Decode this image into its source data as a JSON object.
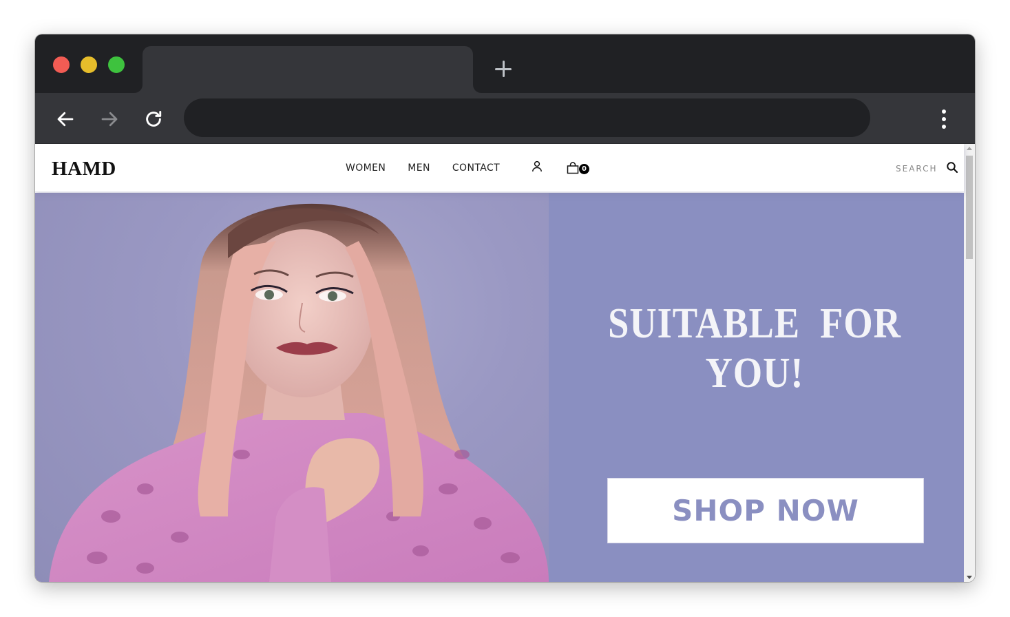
{
  "browser": {
    "tab_title": "",
    "address": "",
    "new_tab_icon": "plus-icon",
    "back_icon": "arrow-left-icon",
    "forward_icon": "arrow-right-icon",
    "reload_icon": "reload-icon",
    "menu_icon": "kebab-menu-icon",
    "colors": {
      "frame": "#202124",
      "toolbar": "#35363a",
      "close": "#f25c54",
      "minimize": "#e6bd2b",
      "maximize": "#3ec23e"
    }
  },
  "site": {
    "logo": "HAMD",
    "nav": {
      "women": "WOMEN",
      "men": "MEN",
      "contact": "CONTACT"
    },
    "cart_count": "0",
    "search_label": "SEARCH"
  },
  "hero": {
    "headline_line1": "SUITABLE  FOR",
    "headline_line2": "YOU!",
    "cta": "SHOP NOW",
    "colors": {
      "background": "#8a8fc1",
      "headline": "#f4f4f8",
      "cta_text": "#8a8fc1"
    }
  }
}
